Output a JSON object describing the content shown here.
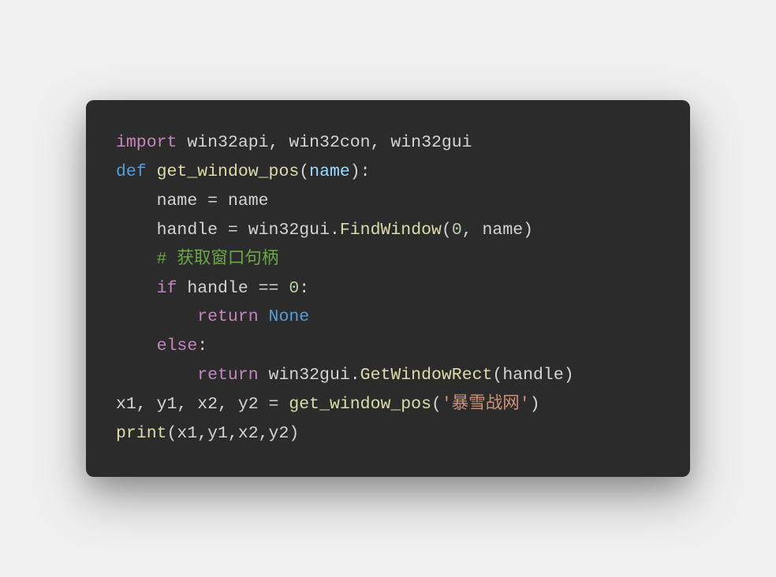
{
  "code": {
    "line1": {
      "kw_import": "import",
      "mods": " win32api, win32con, win32gui"
    },
    "line2": {
      "kw_def": "def",
      "sp1": " ",
      "fn": "get_window_pos",
      "lp": "(",
      "param": "name",
      "rp": "):"
    },
    "line3": {
      "indent": "    ",
      "lhs": "name",
      "eq": " = ",
      "rhs": "name"
    },
    "line4": {
      "indent": "    ",
      "lhs": "handle",
      "eq": " = ",
      "mod": "win32gui",
      "dot": ".",
      "fn": "FindWindow",
      "lp": "(",
      "arg0": "0",
      "comma": ", ",
      "arg1": "name",
      "rp": ")"
    },
    "line5": {
      "indent": "    ",
      "comment": "# 获取窗口句柄"
    },
    "line6": {
      "indent": "    ",
      "kw": "if",
      "sp": " ",
      "var": "handle",
      "op": " == ",
      "num": "0",
      "colon": ":"
    },
    "line7": {
      "indent": "        ",
      "kw": "return",
      "sp": " ",
      "val": "None"
    },
    "line8": {
      "indent": "    ",
      "kw": "else",
      "colon": ":"
    },
    "line9": {
      "indent": "        ",
      "kw": "return",
      "sp": " ",
      "mod": "win32gui",
      "dot": ".",
      "fn": "GetWindowRect",
      "lp": "(",
      "arg": "handle",
      "rp": ")"
    },
    "line10": {
      "vars": "x1, y1, x2, y2",
      "eq": " = ",
      "fn": "get_window_pos",
      "lp": "(",
      "str": "'暴雪战网'",
      "rp": ")"
    },
    "line11": {
      "fn": "print",
      "lp": "(",
      "args": "x1,y1,x2,y2",
      "rp": ")"
    }
  }
}
